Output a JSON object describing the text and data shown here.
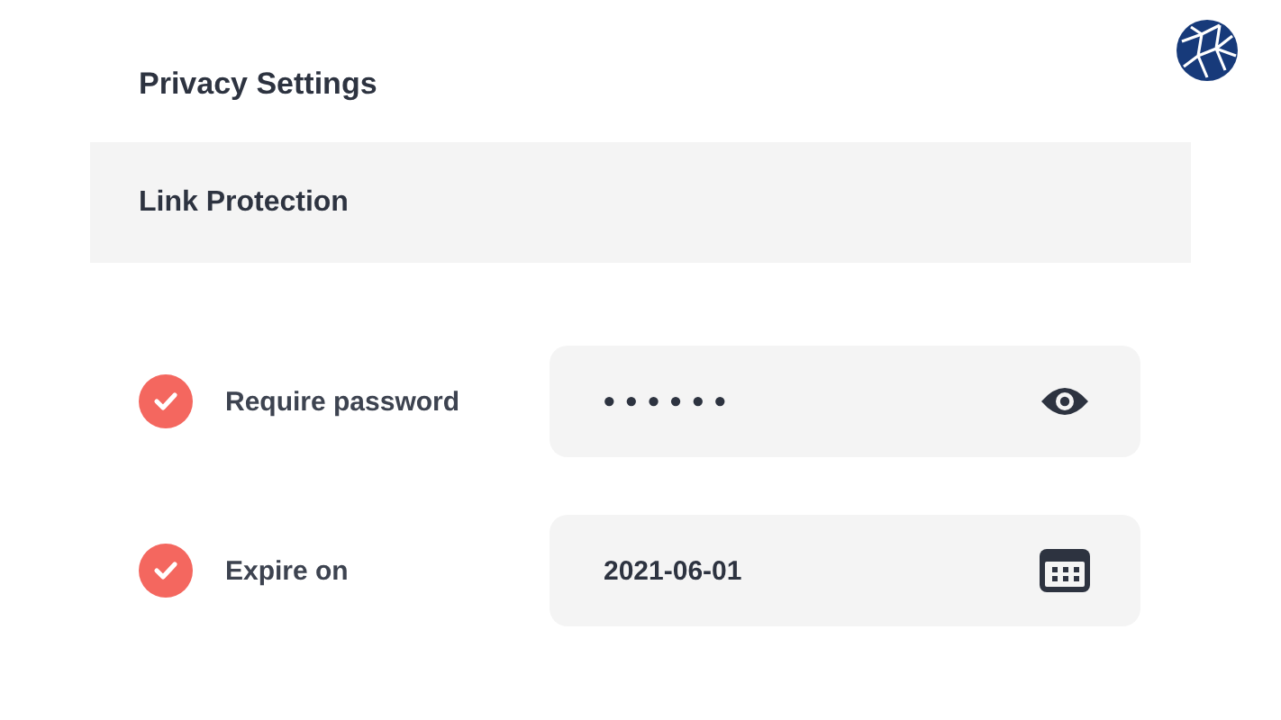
{
  "title": "Privacy Settings",
  "section": {
    "title": "Link Protection"
  },
  "rows": [
    {
      "label": "Require password",
      "checked": true,
      "kind": "password",
      "value": "••••••"
    },
    {
      "label": "Expire on",
      "checked": true,
      "kind": "date",
      "value": "2021-06-01"
    }
  ]
}
